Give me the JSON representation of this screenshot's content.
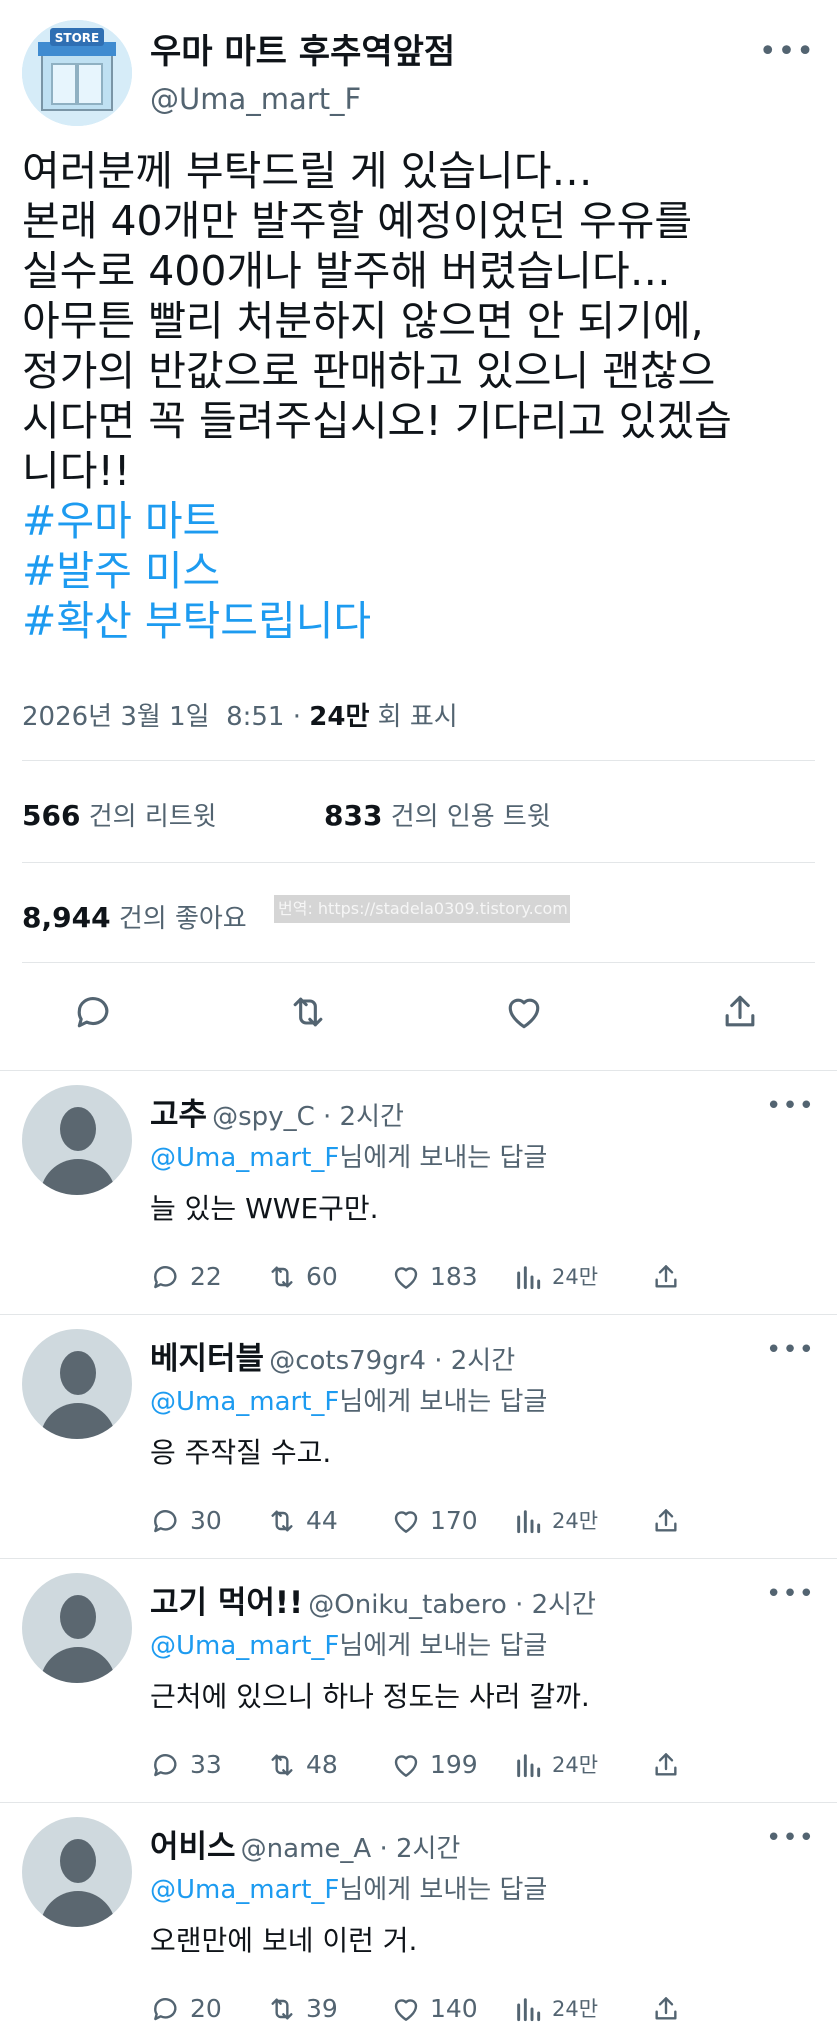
{
  "account": {
    "name": "우마 마트 후추역앞점",
    "handle": "@Uma_mart_F",
    "avatar_label": "STORE",
    "avatar_icon": "store-icon",
    "more_icon": "more-dots-icon"
  },
  "tweet": {
    "lines": [
      "여러분께 부탁드릴 게 있습니다…",
      "본래 40개만 발주할 예정이었던 우유를",
      "실수로 400개나 발주해 버렸습니다…",
      "아무튼 빨리 처분하지 않으면 안 되기에,",
      "정가의 반값으로 판매하고 있으니 괜찮으",
      "시다면 꼭 들려주십시오! 기다리고 있겠습",
      "니다!!"
    ],
    "hashtags": [
      "#우마 마트",
      "#발주 미스",
      "#확산 부탁드립니다"
    ],
    "date": "2026년 3월 1일",
    "time": "8:51",
    "views": "24만",
    "views_label": "회 표시"
  },
  "stats": {
    "retweets": "566",
    "retweets_label": "건의 리트윗",
    "quotes": "833",
    "quotes_label": "건의 인용 트윗",
    "likes": "8,944",
    "likes_label": "건의 좋아요",
    "watermark": "번역: https://stadela0309.tistory.com"
  },
  "actions": [
    "reply-icon",
    "retweet-icon",
    "like-icon",
    "share-icon"
  ],
  "replies": [
    {
      "name": "고추",
      "handle": "@spy_C · 2시간",
      "reply_to_handle": "@Uma_mart_F",
      "reply_to_suffix": "님에게 보내는 답글",
      "text": "늘 있는 WWE구만.",
      "replies": "22",
      "retweets": "60",
      "likes": "183",
      "views": "24만"
    },
    {
      "name": "베지터블",
      "handle": "@cots79gr4 · 2시간",
      "reply_to_handle": "@Uma_mart_F",
      "reply_to_suffix": "님에게 보내는 답글",
      "text": "응 주작질 수고.",
      "replies": "30",
      "retweets": "44",
      "likes": "170",
      "views": "24만"
    },
    {
      "name": "고기 먹어!!",
      "handle": "@Oniku_tabero · 2시간",
      "reply_to_handle": "@Uma_mart_F",
      "reply_to_suffix": "님에게 보내는 답글",
      "text": "근처에 있으니 하나 정도는 사러 갈까.",
      "replies": "33",
      "retweets": "48",
      "likes": "199",
      "views": "24만"
    },
    {
      "name": "어비스",
      "handle": "@name_A · 2시간",
      "reply_to_handle": "@Uma_mart_F",
      "reply_to_suffix": "님에게 보내는 답글",
      "text": "오랜만에 보네 이런 거.",
      "replies": "20",
      "retweets": "39",
      "likes": "140",
      "views": "24만"
    }
  ]
}
